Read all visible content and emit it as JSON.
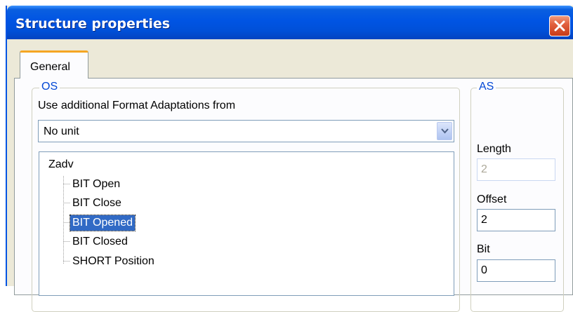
{
  "window": {
    "title": "Structure properties"
  },
  "tabs": [
    {
      "label": "General"
    }
  ],
  "os_group": {
    "legend": "OS",
    "format_label": "Use additional Format Adaptations from",
    "format_select": {
      "value": "No unit"
    },
    "tree": {
      "root": "Zadv",
      "items": [
        {
          "label": "BIT Open",
          "selected": false
        },
        {
          "label": "BIT Close",
          "selected": false
        },
        {
          "label": "BIT Opened",
          "selected": true
        },
        {
          "label": "BIT Closed",
          "selected": false
        },
        {
          "label": "SHORT Position",
          "selected": false
        }
      ]
    }
  },
  "as_group": {
    "legend": "AS",
    "length": {
      "label": "Length",
      "value": "2",
      "disabled": true
    },
    "offset": {
      "label": "Offset",
      "value": "2"
    },
    "bit": {
      "label": "Bit",
      "value": "0"
    }
  },
  "colors": {
    "title_bar": "#0054e3",
    "selection": "#316ac5",
    "group_legend": "#0046d5",
    "close_button": "#e2613f",
    "tab_highlight": "#f5a623"
  },
  "icons": {
    "close": "close-icon",
    "dropdown": "chevron-down-icon"
  }
}
